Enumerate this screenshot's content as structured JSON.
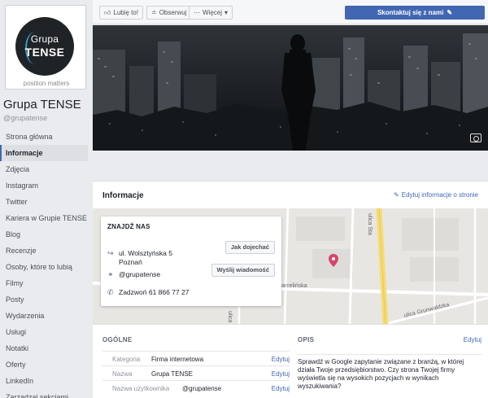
{
  "profile": {
    "logo_line1": "Grupa",
    "logo_line2": "TENSE",
    "tagline": "position matters",
    "name": "Grupa TENSE",
    "handle": "@grupatense"
  },
  "nav": [
    {
      "label": "Strona główna"
    },
    {
      "label": "Informacje"
    },
    {
      "label": "Zdjęcia"
    },
    {
      "label": "Instagram"
    },
    {
      "label": "Twitter"
    },
    {
      "label": "Kariera w Grupie TENSE"
    },
    {
      "label": "Blog"
    },
    {
      "label": "Recenzje"
    },
    {
      "label": "Osoby, które to lubią"
    },
    {
      "label": "Filmy"
    },
    {
      "label": "Posty"
    },
    {
      "label": "Wydarzenia"
    },
    {
      "label": "Usługi"
    },
    {
      "label": "Notatki"
    },
    {
      "label": "Oferty"
    },
    {
      "label": "LinkedIn"
    },
    {
      "label": "Zarządzaj sekcjami"
    }
  ],
  "toolbar": {
    "like": "Lubię to!",
    "follow": "Obserwuj",
    "more": "Więcej",
    "contact": "Skontaktuj się z nami"
  },
  "info": {
    "title": "Informacje",
    "edit_label": "Edytuj informacje o stronie"
  },
  "find_us": {
    "title": "ZNAJDŹ NAS",
    "address_line1": "ul. Wolsztyńska 5",
    "address_line2": "Poznań",
    "directions_button": "Jak dojechać",
    "messenger_handle": "@grupatense",
    "message_button": "Wyślij wiadomość",
    "phone": "Zadzwoń 61 866 77 27"
  },
  "map_labels": {
    "street1": "ulica Sta",
    "street2": "arcelińska",
    "street3": "ulica Grunwaldzka",
    "street4": "ulica"
  },
  "general": {
    "title": "OGÓLNE",
    "rows": [
      {
        "label": "Kategoria",
        "value": "Firma internetowa",
        "edit": "Edytuj"
      },
      {
        "label": "Nazwa",
        "value": "Grupa TENSE",
        "edit": "Edytuj"
      },
      {
        "label": "Nazwa użytkownika",
        "value": "@grupatense",
        "edit": "Edytuj"
      }
    ]
  },
  "description": {
    "title": "OPIS",
    "edit": "Edytuj",
    "text": "Sprawdź w Google zapytanie związane z branżą, w której działa Twoje przedsiębiorstwo. Czy strona Twojej firmy wyświetla się na wysokich pozycjach w wynikach wyszukiwania?"
  },
  "colors": {
    "accent": "#4267b2",
    "page_bg": "#e9ebee",
    "map_pin": "#d6456b",
    "road_yellow": "#f5dc73"
  },
  "icons": {
    "like": "thumbs-up-icon",
    "follow": "rss-icon",
    "more": "dots-icon",
    "edit": "pencil-icon",
    "directions": "arrow-turn-icon",
    "messenger": "messenger-icon",
    "phone": "phone-icon",
    "camera": "camera-icon",
    "map_pin": "map-pin-icon"
  }
}
